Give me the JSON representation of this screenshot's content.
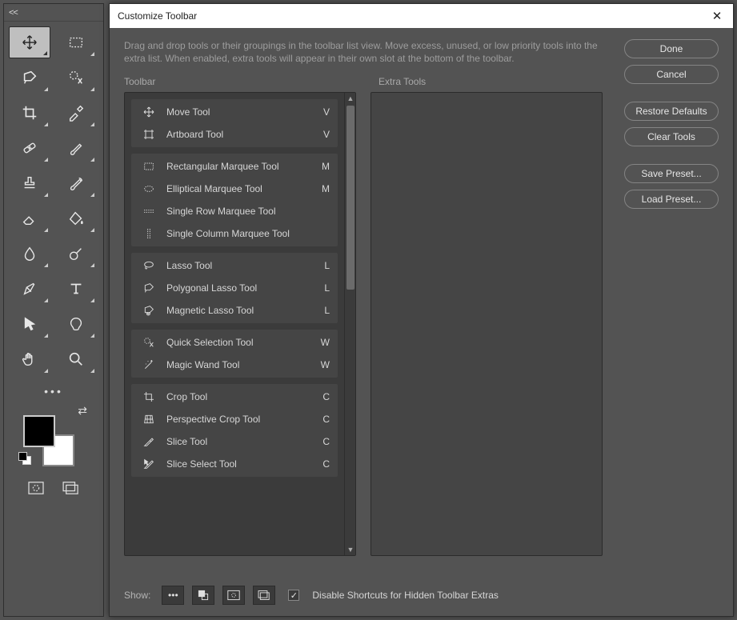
{
  "dialog": {
    "title": "Customize Toolbar",
    "instructions": "Drag and drop tools or their groupings in the toolbar list view. Move excess, unused, or low priority tools into the extra list. When enabled, extra tools will appear in their own slot at the bottom of the toolbar.",
    "toolbar_label": "Toolbar",
    "extra_label": "Extra Tools",
    "show_label": "Show:",
    "disable_shortcuts_label": "Disable Shortcuts for Hidden Toolbar Extras"
  },
  "buttons": {
    "done": "Done",
    "cancel": "Cancel",
    "restore": "Restore Defaults",
    "clear": "Clear Tools",
    "save_preset": "Save Preset...",
    "load_preset": "Load Preset..."
  },
  "groups": [
    {
      "tools": [
        {
          "name": "Move Tool",
          "key": "V",
          "icon": "move"
        },
        {
          "name": "Artboard Tool",
          "key": "V",
          "icon": "artboard"
        }
      ]
    },
    {
      "tools": [
        {
          "name": "Rectangular Marquee Tool",
          "key": "M",
          "icon": "rect-marquee"
        },
        {
          "name": "Elliptical Marquee Tool",
          "key": "M",
          "icon": "ellipse-marquee"
        },
        {
          "name": "Single Row Marquee Tool",
          "key": "",
          "icon": "row-marquee"
        },
        {
          "name": "Single Column Marquee Tool",
          "key": "",
          "icon": "col-marquee"
        }
      ]
    },
    {
      "tools": [
        {
          "name": "Lasso Tool",
          "key": "L",
          "icon": "lasso"
        },
        {
          "name": "Polygonal Lasso Tool",
          "key": "L",
          "icon": "poly-lasso"
        },
        {
          "name": "Magnetic Lasso Tool",
          "key": "L",
          "icon": "magnetic-lasso"
        }
      ]
    },
    {
      "tools": [
        {
          "name": "Quick Selection Tool",
          "key": "W",
          "icon": "quick-select"
        },
        {
          "name": "Magic Wand Tool",
          "key": "W",
          "icon": "wand"
        }
      ]
    },
    {
      "tools": [
        {
          "name": "Crop Tool",
          "key": "C",
          "icon": "crop"
        },
        {
          "name": "Perspective Crop Tool",
          "key": "C",
          "icon": "persp-crop"
        },
        {
          "name": "Slice Tool",
          "key": "C",
          "icon": "slice"
        },
        {
          "name": "Slice Select Tool",
          "key": "C",
          "icon": "slice-select"
        }
      ]
    }
  ],
  "toolbar_tools": [
    "move",
    "rect-marquee",
    "poly-lasso",
    "quick-select",
    "crop",
    "eyedropper",
    "heal",
    "brush",
    "stamp",
    "history-brush",
    "eraser",
    "paint-bucket",
    "blur",
    "dodge",
    "pen",
    "type",
    "path-select",
    "shape",
    "hand",
    "zoom"
  ]
}
